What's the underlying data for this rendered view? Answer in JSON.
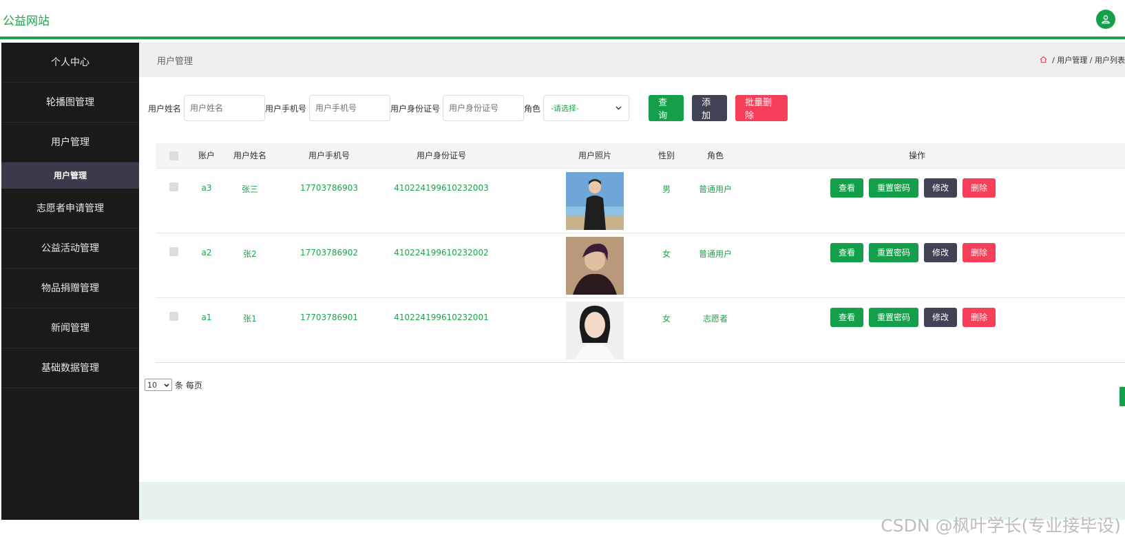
{
  "header": {
    "site_title": "公益网站",
    "avatar_icon": "user-icon"
  },
  "sidebar": {
    "items": [
      {
        "label": "个人中心"
      },
      {
        "label": "轮播图管理"
      },
      {
        "label": "用户管理"
      },
      {
        "label": "志愿者申请管理"
      },
      {
        "label": "公益活动管理"
      },
      {
        "label": "物品捐赠管理"
      },
      {
        "label": "新闻管理"
      },
      {
        "label": "基础数据管理"
      }
    ],
    "active_sub": "用户管理"
  },
  "breadcrumb": {
    "title": "用户管理",
    "path1": "用户管理",
    "path2": "用户列表",
    "sep": "/"
  },
  "search": {
    "name_label": "用户姓名",
    "name_placeholder": "用户姓名",
    "phone_label": "用户手机号",
    "phone_placeholder": "用户手机号",
    "id_label": "用户身份证号",
    "id_placeholder": "用户身份证号",
    "role_label": "角色",
    "role_value": "-请选择-",
    "query_label": "查询",
    "add_label": "添加",
    "batch_delete_label": "批量删除"
  },
  "table": {
    "headers": {
      "account": "账户",
      "name": "用户姓名",
      "phone": "用户手机号",
      "idcard": "用户身份证号",
      "photo": "用户照片",
      "gender": "性别",
      "role": "角色",
      "ops": "操作"
    },
    "rows": [
      {
        "account": "a3",
        "name": "张三",
        "phone": "17703786903",
        "idcard": "410224199610232003",
        "gender": "男",
        "role": "普通用户"
      },
      {
        "account": "a2",
        "name": "张2",
        "phone": "17703786902",
        "idcard": "410224199610232002",
        "gender": "女",
        "role": "普通用户"
      },
      {
        "account": "a1",
        "name": "张1",
        "phone": "17703786901",
        "idcard": "410224199610232001",
        "gender": "女",
        "role": "志愿者"
      }
    ],
    "op_labels": {
      "view": "查看",
      "reset": "重置密码",
      "edit": "修改",
      "delete": "删除"
    }
  },
  "pager": {
    "page_size": "10",
    "suffix": "条 每页"
  },
  "watermark": "CSDN @枫叶学长(专业接毕设)"
}
